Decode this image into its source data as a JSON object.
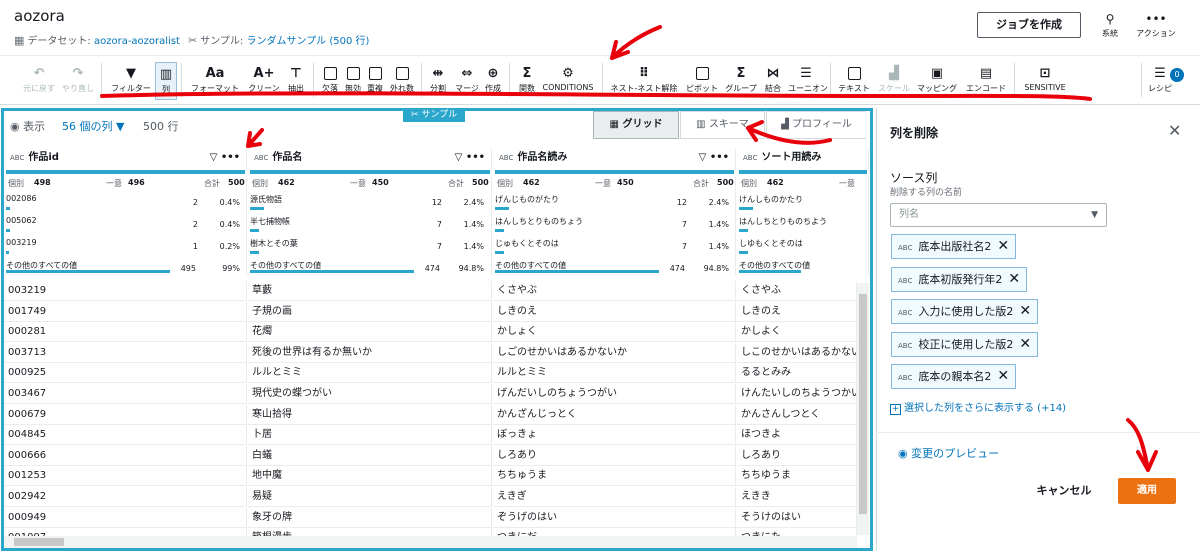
{
  "header": {
    "project_title": "aozora",
    "dataset_label": "データセット:",
    "dataset_name": "aozora-aozoralist",
    "sample_label": "サンプル:",
    "sample_value": "ランダムサンプル (500 行)",
    "create_job": "ジョブを作成",
    "lineage": "系統",
    "actions": "アクション"
  },
  "toolbar": {
    "undo": "元に戻す",
    "redo": "やり直し",
    "filter": "フィルター",
    "column": "列",
    "format": "フォーマット",
    "clean": "クリーン",
    "extract": "抽出",
    "missing": "欠落",
    "invalid": "無効",
    "duplicate": "重複",
    "outliers": "外れ数",
    "split": "分割",
    "merge": "マージ",
    "create": "作成",
    "functions": "関数",
    "conditions": "CONDITIONS",
    "nest": "ネスト-ネスト解除",
    "pivot": "ピボット",
    "group": "グループ",
    "join": "結合",
    "union": "ユーニオン",
    "text": "テキスト",
    "scale": "スケール",
    "mapping": "マッピング",
    "encode": "エンコード",
    "sensitive": "SENSITIVE",
    "recipe": "レシピ",
    "recipe_count": "0",
    "icons": {
      "fx": "Σ",
      "format_glyph": "Aa",
      "clean_glyph": "A+",
      "conditions_glyph": "⚙"
    }
  },
  "grid": {
    "sample_tag": "サンプル",
    "view_label": "表示",
    "columns_dropdown": "56 個の列 ▼",
    "rows": "500 行",
    "tabs": [
      "グリッド",
      "スキーマ",
      "プロフィール"
    ],
    "type_tag": "ABC",
    "columns": [
      {
        "name": "作品id",
        "distinct": "498",
        "unique": "496",
        "total": "500",
        "top": [
          [
            "002086",
            "2",
            "0.4%"
          ],
          [
            "005062",
            "2",
            "0.4%"
          ],
          [
            "003219",
            "1",
            "0.2%"
          ]
        ],
        "other": [
          "その他のすべての値",
          "495",
          "99%"
        ]
      },
      {
        "name": "作品名",
        "distinct": "462",
        "unique": "450",
        "total": "500",
        "top": [
          [
            "源氏物語",
            "12",
            "2.4%"
          ],
          [
            "半七捕物帳",
            "7",
            "1.4%"
          ],
          [
            "樹木とその葉",
            "7",
            "1.4%"
          ]
        ],
        "other": [
          "その他のすべての値",
          "474",
          "94.8%"
        ]
      },
      {
        "name": "作品名読み",
        "distinct": "462",
        "unique": "450",
        "total": "500",
        "top": [
          [
            "げんじものがたり",
            "12",
            "2.4%"
          ],
          [
            "はんしちとりものちょう",
            "7",
            "1.4%"
          ],
          [
            "じゅもくとそのは",
            "7",
            "1.4%"
          ]
        ],
        "other": [
          "その他のすべての値",
          "474",
          "94.8%"
        ]
      },
      {
        "name": "ソート用読み",
        "distinct": "462",
        "unique": "",
        "total": "50",
        "top": [
          [
            "けんしものかたり",
            "",
            ""
          ],
          [
            "はんしちとりものちよう",
            "",
            ""
          ],
          [
            "しゆもくとそのは",
            "",
            ""
          ]
        ],
        "other": [
          "その他のすべての値",
          "",
          ""
        ]
      }
    ],
    "stat_labels": {
      "distinct": "個別",
      "unique": "一意",
      "total": "合計"
    },
    "rows_data": [
      [
        "003219",
        "草藪",
        "くさやぶ",
        "くさやふ"
      ],
      [
        "001749",
        "子規の画",
        "しきのえ",
        "しきのえ"
      ],
      [
        "000281",
        "花燭",
        "かしょく",
        "かしよく"
      ],
      [
        "003713",
        "死後の世界は有るか無いか",
        "しごのせかいはあるかないか",
        "しこのせかいはあるかない"
      ],
      [
        "000925",
        "ルルとミミ",
        "ルルとミミ",
        "るるとみみ"
      ],
      [
        "003467",
        "現代史の蝶つがい",
        "げんだいしのちょうつがい",
        "けんたいしのちようつかい"
      ],
      [
        "000679",
        "寒山拾得",
        "かんざんじっとく",
        "かんさんしつとく"
      ],
      [
        "004845",
        "卜居",
        "ぼっきょ",
        "ほつきよ"
      ],
      [
        "000666",
        "白蟻",
        "しろあり",
        "しろあり"
      ],
      [
        "001253",
        "地中魔",
        "ちちゅうま",
        "ちちゆうま"
      ],
      [
        "002942",
        "易疑",
        "えきぎ",
        "えきき"
      ],
      [
        "000949",
        "象牙の牌",
        "ぞうげのはい",
        "そうけのはい"
      ],
      [
        "001097",
        "箱根漫歩",
        "つきにだ",
        "つきにた"
      ]
    ]
  },
  "panel": {
    "title": "列を削除",
    "source_label": "ソース列",
    "source_desc": "削除する列の名前",
    "select_placeholder": "列名",
    "chips": [
      "底本出版社名2",
      "底本初版発行年2",
      "入力に使用した版2",
      "校正に使用した版2",
      "底本の親本名2"
    ],
    "show_more": "選択した列をさらに表示する (+14)",
    "preview": "変更のプレビュー",
    "cancel": "キャンセル",
    "apply": "適用"
  },
  "colors": {
    "accent": "#0073bb",
    "teal": "#2ba6cc",
    "apply": "#ec7211",
    "annotation": "#e8000b"
  }
}
